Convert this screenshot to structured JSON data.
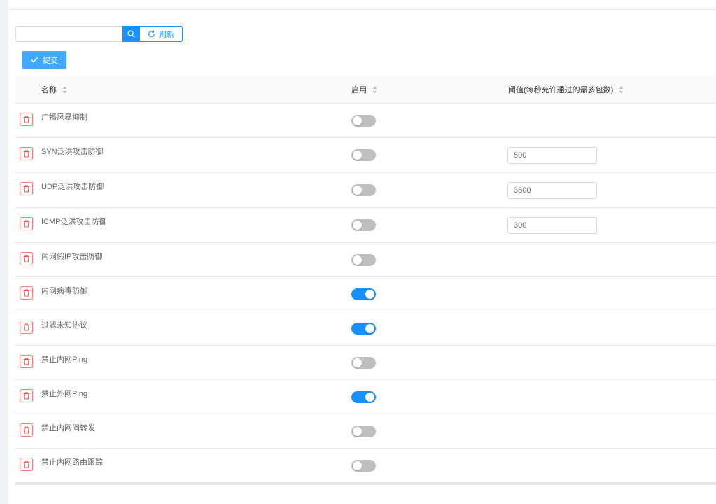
{
  "toolbar": {
    "search_value": "",
    "refresh_label": "刷新",
    "submit_label": "提交"
  },
  "table": {
    "columns": [
      {
        "label": "名称",
        "sortable": true
      },
      {
        "label": "启用",
        "sortable": true
      },
      {
        "label": "阈值(每秒允许通过的最多包数)",
        "sortable": true
      }
    ],
    "rows": [
      {
        "name": "广播风暴抑制",
        "enabled": false
      },
      {
        "name": "SYN泛洪攻击防御",
        "enabled": false,
        "threshold": "500"
      },
      {
        "name": "UDP泛洪攻击防御",
        "enabled": false,
        "threshold": "3600"
      },
      {
        "name": "ICMP泛洪攻击防御",
        "enabled": false,
        "threshold": "300"
      },
      {
        "name": "内网假IP攻击防御",
        "enabled": false
      },
      {
        "name": "内网病毒防御",
        "enabled": true
      },
      {
        "name": "过滤未知协议",
        "enabled": true
      },
      {
        "name": "禁止内网Ping",
        "enabled": false
      },
      {
        "name": "禁止外网Ping",
        "enabled": true
      },
      {
        "name": "禁止内网间转发",
        "enabled": false
      },
      {
        "name": "禁止内网路由跟踪",
        "enabled": false
      }
    ]
  },
  "icons": {
    "search": "search-icon",
    "refresh": "refresh-icon",
    "submit": "check-icon",
    "delete": "trash-icon",
    "sort": "sort-icon"
  },
  "colors": {
    "primary": "#1890ff",
    "submit_bg": "#40a9ff",
    "danger": "#ff4d4f",
    "toggle_off": "#bfbfbf",
    "header_bg": "#fafafa",
    "border": "#e8e8e8",
    "page_bg": "#f0f2f5"
  }
}
